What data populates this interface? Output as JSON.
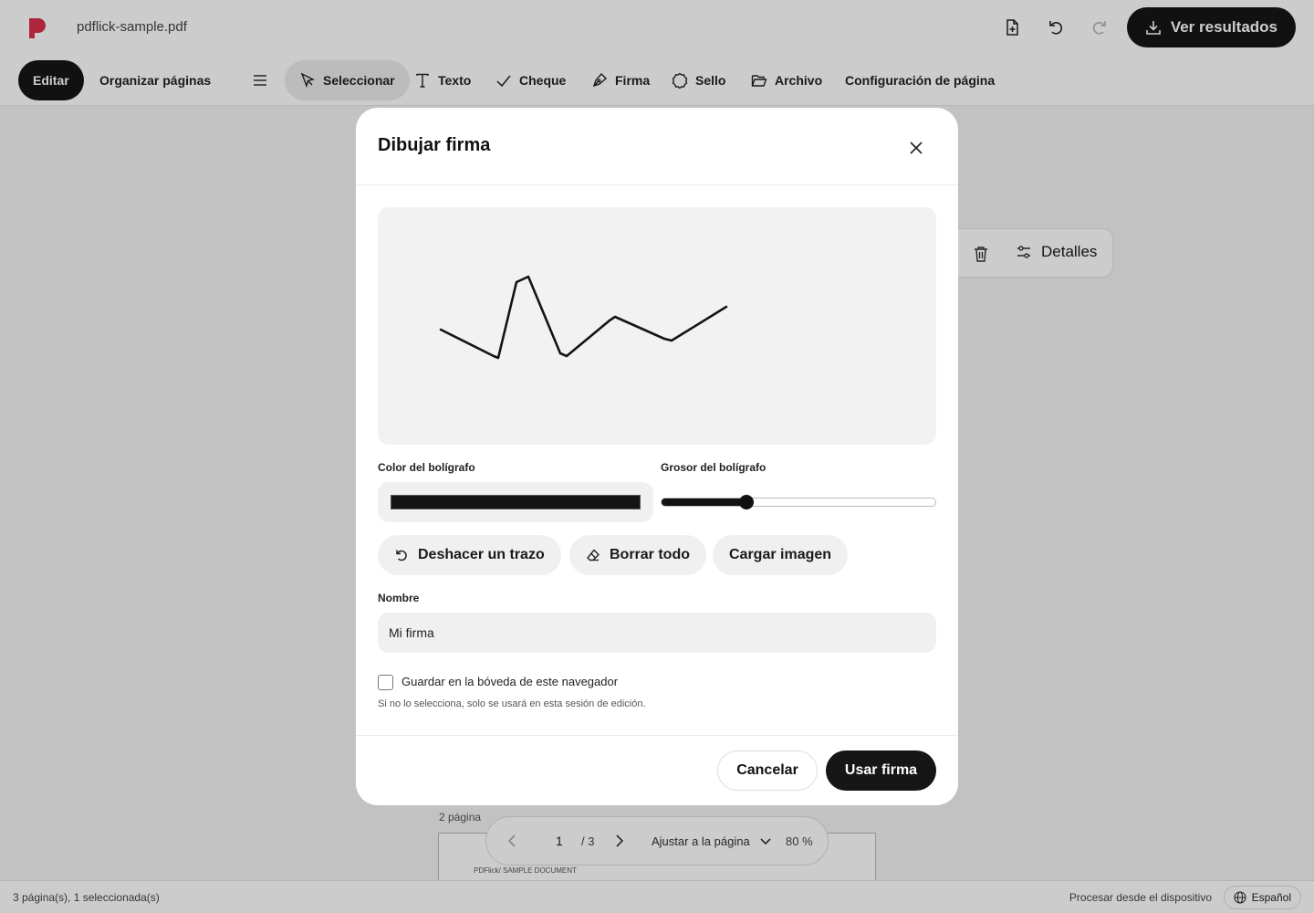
{
  "app": {
    "filename": "pdflick-sample.pdf",
    "results_button": "Ver resultados"
  },
  "toolbar": {
    "edit": "Editar",
    "organize": "Organizar páginas",
    "select": "Seleccionar",
    "text": "Texto",
    "check": "Cheque",
    "signature": "Firma",
    "stamp": "Sello",
    "file": "Archivo",
    "page_settings": "Configuración de página"
  },
  "floating_tools": {
    "details": "Detalles"
  },
  "document": {
    "page_label": "2 página",
    "thumb_text": "PDFlick/ SAMPLE DOCUMENT"
  },
  "pager": {
    "current_page": "1",
    "total": "/ 3",
    "fit_mode": "Ajustar a la página",
    "zoom": "80 %"
  },
  "status": {
    "pages_info": "3 página(s), 1 seleccionada(s)",
    "process_local": "Procesar desde el dispositivo",
    "language": "Español"
  },
  "modal": {
    "title": "Dibujar firma",
    "pen_color_label": "Color del bolígrafo",
    "pen_color": "#141414",
    "pen_thickness_label": "Grosor del bolígrafo",
    "pen_thickness_fraction": 0.31,
    "undo_stroke": "Deshacer un trazo",
    "clear_all": "Borrar todo",
    "upload_image": "Cargar imagen",
    "name_label": "Nombre",
    "name_value": "Mi firma",
    "save_checkbox_label": "Guardar en la bóveda de este navegador",
    "save_checked": false,
    "help_text": "Si no lo selecciona, solo se usará en esta sesión de edición.",
    "cancel": "Cancelar",
    "use_signature": "Usar firma"
  },
  "colors": {
    "accent_dark": "#161616",
    "brand_logo": "#d9304a"
  }
}
